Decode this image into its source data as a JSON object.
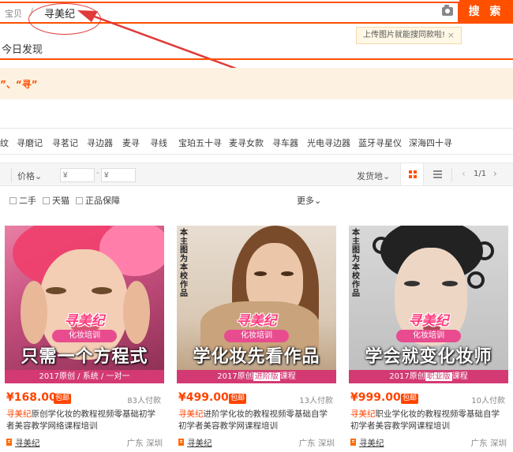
{
  "search": {
    "scope": "宝贝",
    "query": "寻美纪",
    "button_label": "搜 索"
  },
  "tooltip": {
    "text": "上传图片就能搜同款啦!",
    "close": "×"
  },
  "today": "今日发现",
  "notice": {
    "text": "”、“寻”"
  },
  "related": [
    "纹",
    "寻磨记",
    "寻茗记",
    "寻边器",
    "麦寻",
    "寻线",
    "宝珀五十寻",
    "麦寻女款",
    "寻车器",
    "光电寻边器",
    "蓝牙寻星仪",
    "深海四十寻"
  ],
  "sortbar": {
    "price_label": "价格",
    "price_min_placeholder": "¥",
    "price_max_placeholder": "¥",
    "dash": "-",
    "ship_label": "发货地",
    "prev": "‹",
    "pages": "1/1",
    "next": "›"
  },
  "filters": {
    "items": [
      "二手",
      "天猫",
      "正品保障"
    ],
    "more": "更多"
  },
  "products": [
    {
      "logo": "寻美纪",
      "course": "化妆培训",
      "headline": "只需一个方程式",
      "sub_before": "2017原创 / 系统 / 一对一",
      "sub_hl": "",
      "sub_after": "",
      "vlabel": "",
      "price": "¥168.00",
      "badge": "包邮",
      "sales": "83人付款",
      "title_hl": "寻美纪",
      "title_rest": "原创学化妆的教程视频零基础初学者美容教学网络课程培训",
      "shop": "寻美纪",
      "location": "广东 深圳"
    },
    {
      "logo": "寻美纪",
      "course": "化妆培训",
      "headline": "学化妆先看作品",
      "sub_before": "2017原创",
      "sub_hl": "进阶版",
      "sub_after": "课程",
      "vlabel": "本主图为本校作品",
      "price": "¥499.00",
      "badge": "包邮",
      "sales": "13人付款",
      "title_hl": "寻美纪",
      "title_rest": "进阶学化妆的教程视频零基础自学初学者美容教学网课程培训",
      "shop": "寻美纪",
      "location": "广东 深圳"
    },
    {
      "logo": "寻美纪",
      "course": "化妆培训",
      "headline": "学会就变化妆师",
      "sub_before": "2017原创",
      "sub_hl": "职业版",
      "sub_after": "课程",
      "vlabel": "本主图为本校作品",
      "price": "¥999.00",
      "badge": "包邮",
      "sales": "10人付款",
      "title_hl": "寻美纪",
      "title_rest": "职业学化妆的教程视频零基础自学初学者美容教学网课程培训",
      "shop": "寻美纪",
      "location": "广东 深圳"
    }
  ],
  "colors": {
    "accent": "#ff5000",
    "price": "#ff4400",
    "notice_bg": "#fdf1e2",
    "annotation": "#e03a3a"
  }
}
